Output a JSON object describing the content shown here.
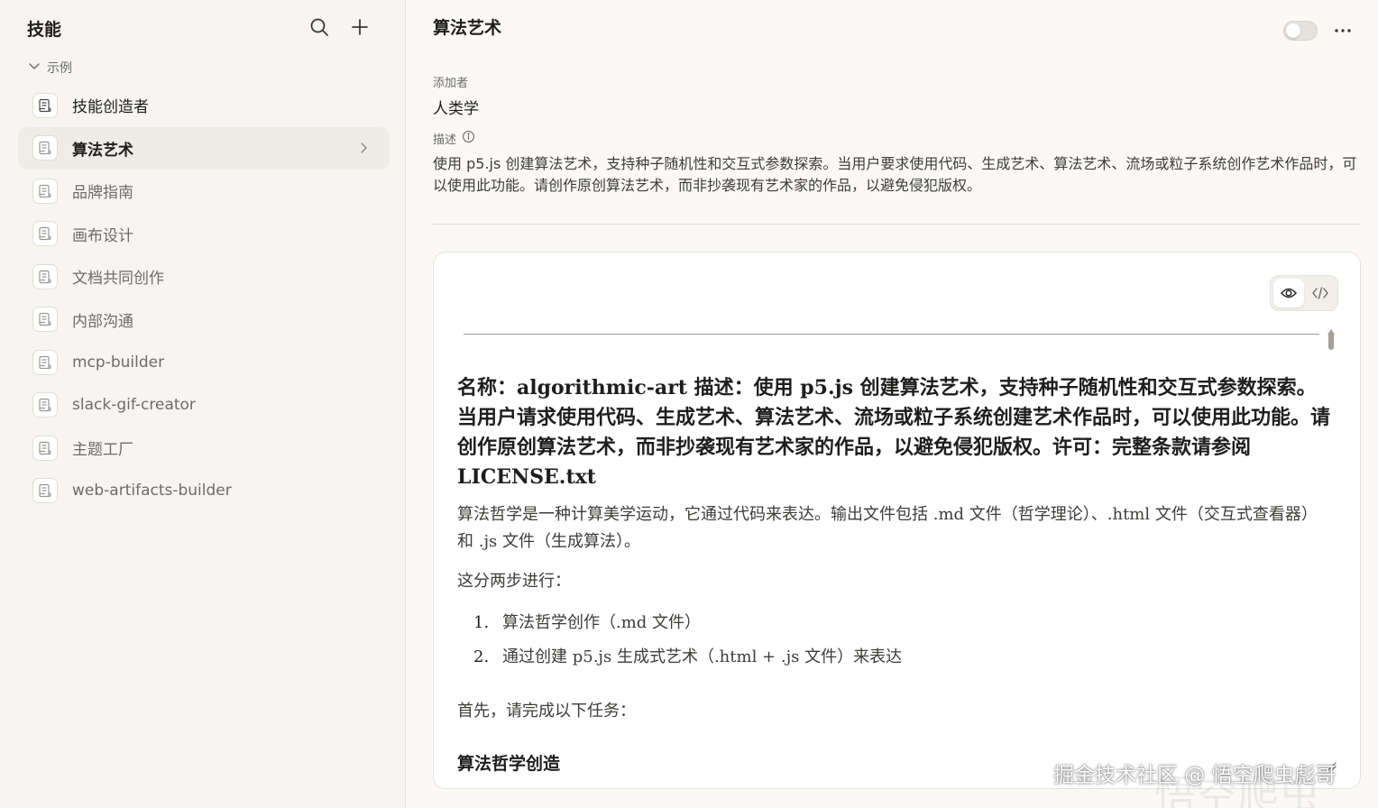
{
  "sidebar": {
    "title": "技能",
    "group_label": "示例",
    "items": [
      {
        "label": "技能创造者"
      },
      {
        "label": "算法艺术"
      },
      {
        "label": "品牌指南"
      },
      {
        "label": "画布设计"
      },
      {
        "label": "文档共同创作"
      },
      {
        "label": "内部沟通"
      },
      {
        "label": "mcp-builder"
      },
      {
        "label": "slack-gif-creator"
      },
      {
        "label": "主题工厂"
      },
      {
        "label": "web-artifacts-builder"
      }
    ]
  },
  "main": {
    "title": "算法艺术",
    "added_by_label": "添加者",
    "added_by_value": "人类学",
    "description_label": "描述",
    "description": "使用 p5.js 创建算法艺术，支持种子随机性和交互式参数探索。当用户要求使用代码、生成艺术、算法艺术、流场或粒子系统创作艺术作品时，可以使用此功能。请创作原创算法艺术，而非抄袭现有艺术家的作品，以避免侵犯版权。"
  },
  "document": {
    "heading": "名称：algorithmic-art 描述：使用 p5.js 创建算法艺术，支持种子随机性和交互式参数探索。当用户请求使用代码、生成艺术、算法艺术、流场或粒子系统创建艺术作品时，可以使用此功能。请创作原创算法艺术，而非抄袭现有艺术家的作品，以避免侵犯版权。许可：完整条款请参阅 LICENSE.txt",
    "intro": "算法哲学是一种计算美学运动，它通过代码来表达。输出文件包括 .md 文件（哲学理论）、.html 文件（交互式查看器）和 .js 文件（生成算法）。",
    "steps_intro": "这分两步进行：",
    "steps": [
      {
        "num": "1.",
        "text": "算法哲学创作（.md 文件）"
      },
      {
        "num": "2.",
        "text": "通过创建 p5.js 生成式艺术（.html + .js 文件）来表达"
      }
    ],
    "first_task": "首先，请完成以下任务：",
    "section_heading": "算法哲学创造"
  },
  "watermark": "掘金技术社区 @ 悟空爬虫彪哥",
  "watermark_bg": "悟空爬虫",
  "colors": {
    "sidebar_bg": "#f6f5f1",
    "main_bg": "#faf9f6",
    "active_item_bg": "#eeece6",
    "text_primary": "#1f1e1d",
    "text_muted": "#6e6c68"
  },
  "icons": {
    "search": "search-icon",
    "add": "plus-icon",
    "group": "chevron-down-icon",
    "skill": "scroll-icon",
    "active_chevron": "chevron-right-icon",
    "more": "ellipsis-icon",
    "info": "info-icon",
    "preview": "eye-icon",
    "code": "code-icon"
  }
}
